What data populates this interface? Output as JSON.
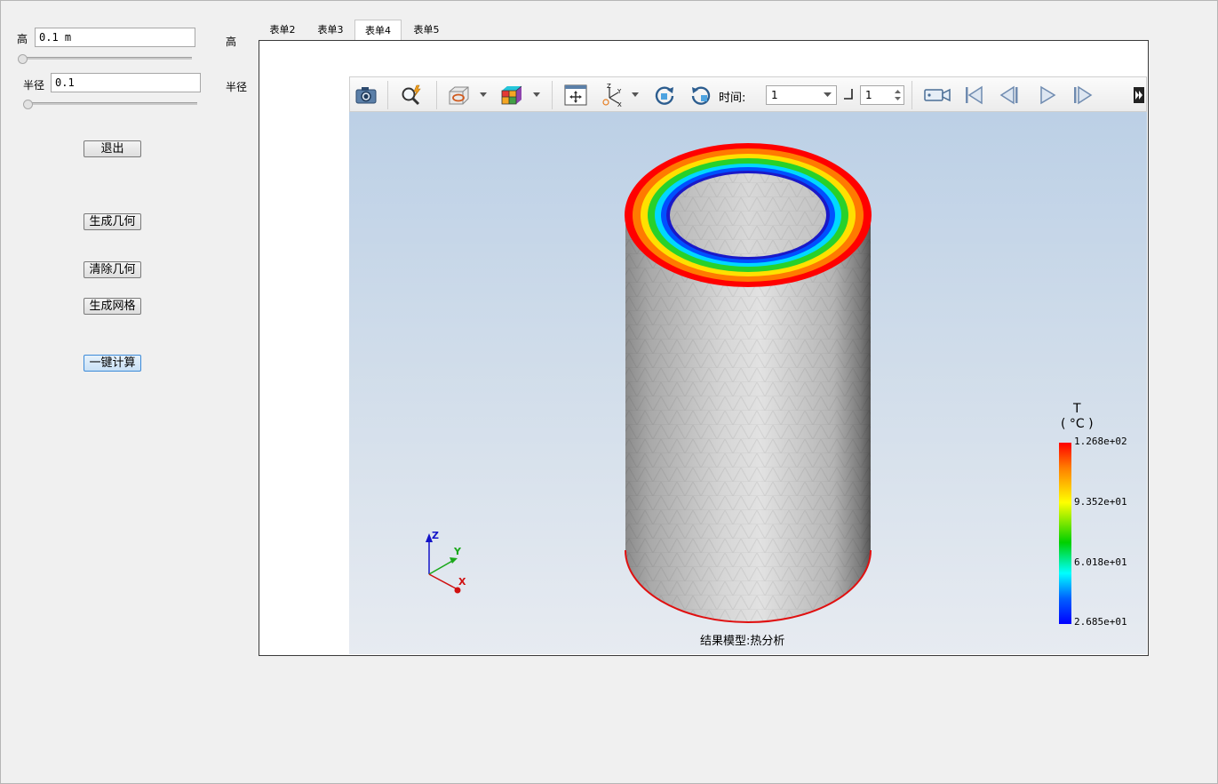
{
  "left_panel": {
    "height_label": "高",
    "height_value": "0.1 m",
    "height_side_label": "高",
    "height_slider": 0.0,
    "radius_label": "半径",
    "radius_value": "0.1",
    "radius_side_label": "半径",
    "radius_slider": 0.0,
    "buttons": {
      "exit": "退出",
      "generate_geometry": "生成几何",
      "clear_geometry": "清除几何",
      "generate_mesh": "生成网格",
      "one_click_compute": "一键计算"
    }
  },
  "tabs": [
    {
      "label": "表单2",
      "selected": false
    },
    {
      "label": "表单3",
      "selected": false
    },
    {
      "label": "表单4",
      "selected": true
    },
    {
      "label": "表单5",
      "selected": false
    }
  ],
  "toolbar": {
    "icons": [
      "camera-icon",
      "magnify-icon",
      "section-view-icon",
      "colormap-cube-icon",
      "fit-view-icon",
      "axes-view-icon",
      "rotate-cw-icon",
      "rotate-ccw-icon",
      "record-video-icon",
      "first-frame-icon",
      "prev-frame-icon",
      "play-icon",
      "next-frame-icon",
      "more-icon"
    ],
    "time_label": "时间:",
    "time_value": "1",
    "step_value": "1"
  },
  "viewport": {
    "model_caption": "结果模型:热分析",
    "axes": {
      "x": "X",
      "y": "Y",
      "z": "Z"
    },
    "legend": {
      "title": "T",
      "unit": "( °C )",
      "labels": [
        "1.268e+02",
        "9.352e+01",
        "6.018e+01",
        "2.685e+01"
      ]
    }
  },
  "colors": {
    "accent_button": "#c9e1f6",
    "viewport_top": "#bcd0e6",
    "viewport_bottom": "#e7ebf1"
  }
}
